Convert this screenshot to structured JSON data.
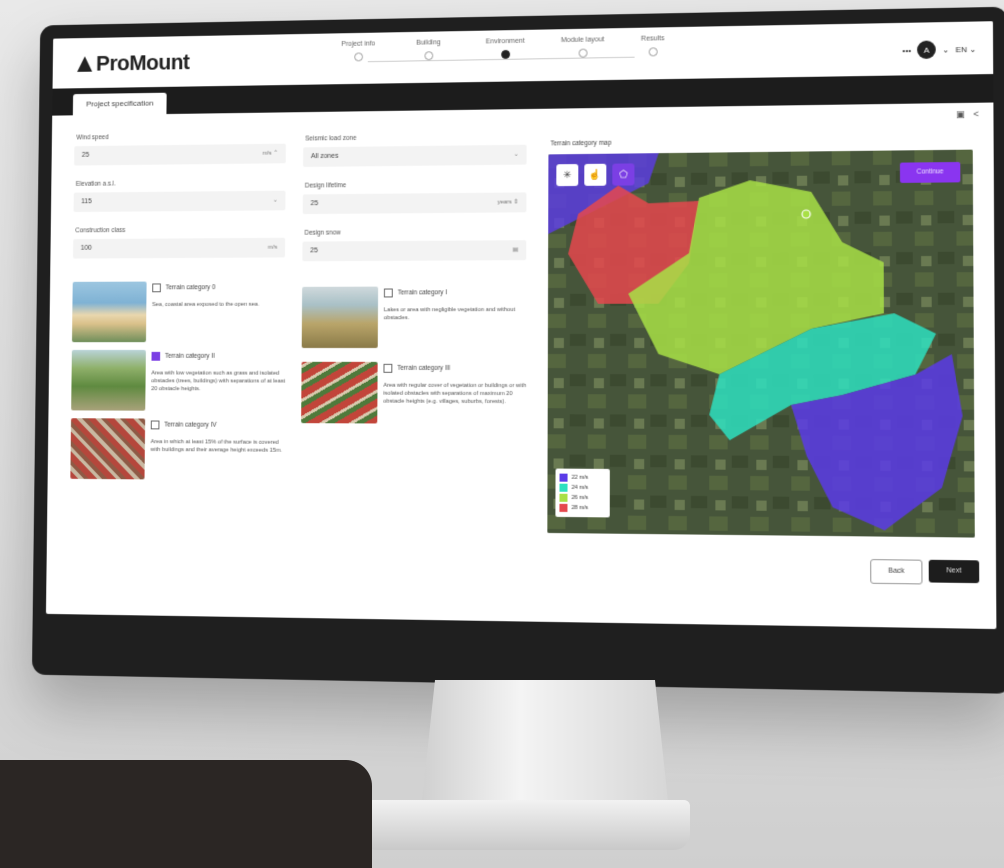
{
  "app": {
    "brand": "ProMount"
  },
  "stepper": [
    {
      "label": "Project info",
      "state": "done"
    },
    {
      "label": "Building",
      "state": "done"
    },
    {
      "label": "Environment",
      "state": "active"
    },
    {
      "label": "Module layout",
      "state": "todo"
    },
    {
      "label": "Results",
      "state": "todo"
    }
  ],
  "header": {
    "more": "•••",
    "avatar_initial": "A",
    "language": "EN"
  },
  "tab": {
    "label": "Project specification"
  },
  "form": {
    "wind_speed": {
      "label": "Wind speed",
      "value": "25",
      "unit": "m/s"
    },
    "elevation": {
      "label": "Elevation a.s.l.",
      "value": "115"
    },
    "construction_class": {
      "label": "Construction class",
      "value": "100",
      "unit": "m/s"
    },
    "seismic_zone": {
      "label": "Seismic load zone",
      "value": "All zones"
    },
    "design_lifetime": {
      "label": "Design lifetime",
      "value": "25",
      "unit": "years"
    },
    "design_snow": {
      "label": "Design snow",
      "value": "25"
    }
  },
  "categories": [
    {
      "title": "Terrain category 0",
      "desc": "Sea, coastal area exposed to the open sea.",
      "checked": false
    },
    {
      "title": "Terrain category II",
      "desc": "Area with low vegetation such as grass and isolated obstacles (trees, buildings) with separations of at least 20 obstacle heights.",
      "checked": true
    },
    {
      "title": "Terrain category IV",
      "desc": "Area in which at least 15% of the surface is covered with buildings and their average height exceeds 15m.",
      "checked": false
    },
    {
      "title": "Terrain category I",
      "desc": "Lakes or area with negligible vegetation and without obstacles.",
      "checked": false
    },
    {
      "title": "Terrain category III",
      "desc": "Area with regular cover of vegetation or buildings or with isolated obstacles with separations of maximum 20 obstacle heights (e.g. villages, suburbs, forests).",
      "checked": false
    }
  ],
  "map": {
    "title": "Terrain category map",
    "cta": "Continue",
    "legend": [
      {
        "label": "22 m/s",
        "color": "#5b3be8"
      },
      {
        "label": "24 m/s",
        "color": "#2ee0c0"
      },
      {
        "label": "26 m/s",
        "color": "#a8e046"
      },
      {
        "label": "28 m/s",
        "color": "#e5484d"
      }
    ]
  },
  "actions": {
    "back": "Back",
    "next": "Next"
  }
}
